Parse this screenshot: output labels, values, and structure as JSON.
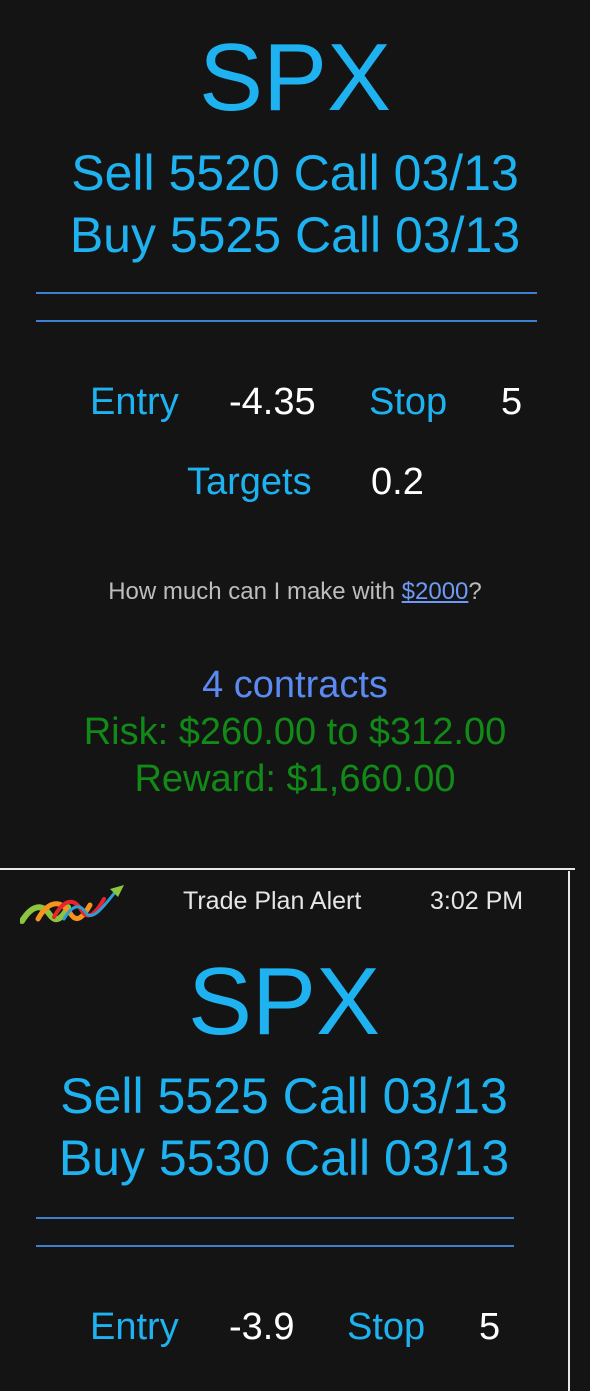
{
  "alerts": [
    {
      "ticker": "SPX",
      "legs": [
        "Sell 5520 Call 03/13",
        "Buy 5525 Call 03/13"
      ],
      "entry_label": "Entry",
      "entry_value": "-4.35",
      "stop_label": "Stop",
      "stop_value": "5",
      "targets_label": "Targets",
      "targets_value": "0.2",
      "question_prefix": "How much can I make with ",
      "question_amount": "$2000",
      "question_suffix": "?",
      "contracts": "4 contracts",
      "risk": "Risk: $260.00 to $312.00",
      "reward": "Reward: $1,660.00"
    },
    {
      "header_title": "Trade Plan Alert",
      "header_time": "3:02 PM",
      "logo_icon": "trade-logo-icon",
      "ticker": "SPX",
      "legs": [
        "Sell 5525 Call 03/13",
        "Buy 5530 Call 03/13"
      ],
      "entry_label": "Entry",
      "entry_value": "-3.9",
      "stop_label": "Stop",
      "stop_value": "5"
    }
  ],
  "colors": {
    "background": "#141414",
    "accent_blue": "#1fb2f0",
    "contracts_blue": "#5b8af2",
    "risk_green": "#118a18",
    "rule_blue": "#3f7fd1"
  }
}
